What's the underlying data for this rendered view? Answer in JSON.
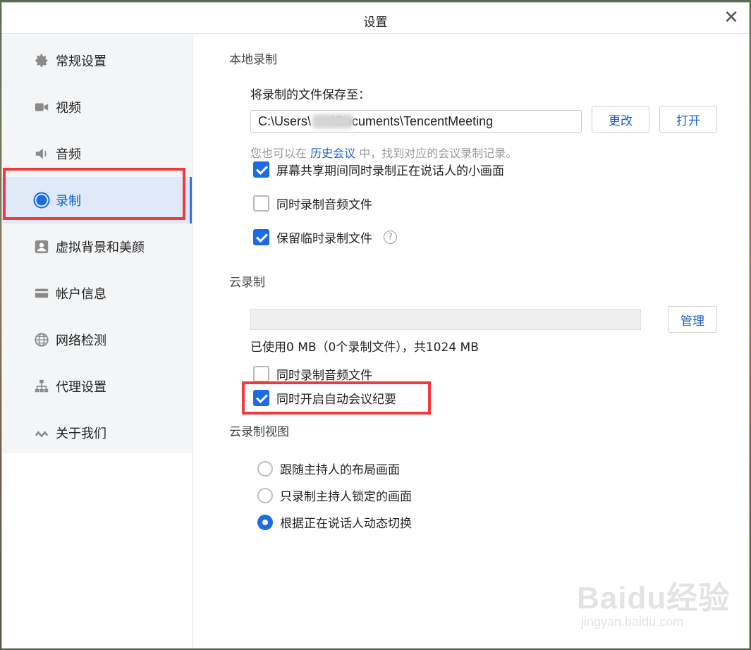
{
  "window": {
    "title": "设置",
    "close_symbol": "✕"
  },
  "sidebar": {
    "items": [
      {
        "label": "常规设置",
        "icon": "gear-icon",
        "active": false
      },
      {
        "label": "视频",
        "icon": "video-camera-icon",
        "active": false
      },
      {
        "label": "音频",
        "icon": "speaker-icon",
        "active": false
      },
      {
        "label": "录制",
        "icon": "record-icon",
        "active": true
      },
      {
        "label": "虚拟背景和美颜",
        "icon": "portrait-icon",
        "active": false
      },
      {
        "label": "帐户信息",
        "icon": "card-icon",
        "active": false
      },
      {
        "label": "网络检测",
        "icon": "globe-icon",
        "active": false
      },
      {
        "label": "代理设置",
        "icon": "network-tree-icon",
        "active": false
      },
      {
        "label": "关于我们",
        "icon": "brand-logo-icon",
        "active": false
      }
    ]
  },
  "local_recording": {
    "section_title": "本地录制",
    "save_to_label": "将录制的文件保存至：",
    "path_value": "C:\\Users\\      \\Documents\\TencentMeeting",
    "change_button": "更改",
    "open_button": "打开",
    "hint_prefix": "您也可以在 ",
    "hint_link": "历史会议",
    "hint_suffix": " 中，找到对应的会议录制记录。",
    "options": [
      {
        "label": "屏幕共享期间同时录制正在说话人的小画面",
        "checked": true
      },
      {
        "label": "同时录制音频文件",
        "checked": false
      },
      {
        "label": "保留临时录制文件",
        "checked": true
      }
    ],
    "help_symbol": "?"
  },
  "cloud_recording": {
    "section_title": "云录制",
    "manage_button": "管理",
    "usage_text": "已使用0 MB（0个录制文件），共1024 MB",
    "storage_used_fraction": 0,
    "options": [
      {
        "label": "同时录制音频文件",
        "checked": false
      },
      {
        "label": "同时开启自动会议纪要",
        "checked": true
      }
    ]
  },
  "cloud_view": {
    "section_title": "云录制视图",
    "options": [
      {
        "label": "跟随主持人的布局画面",
        "selected": false
      },
      {
        "label": "只录制主持人锁定的画面",
        "selected": false
      },
      {
        "label": "根据正在说话人动态切换",
        "selected": true
      }
    ]
  },
  "watermark": {
    "main": "Baidu经验",
    "sub": "jingyan.baidu.com"
  },
  "colors": {
    "accent": "#1d6ae5",
    "highlight_box": "#ef3b3b",
    "active_nav_bg": "#dfe9f8"
  }
}
